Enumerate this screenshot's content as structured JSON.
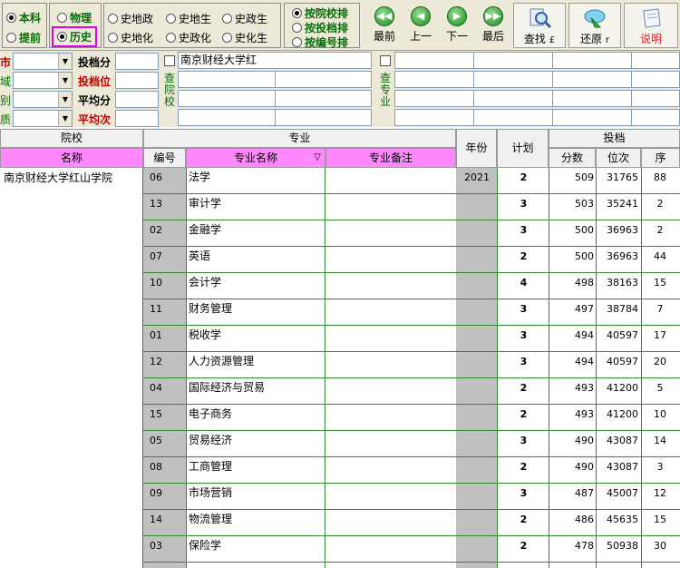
{
  "toolbar": {
    "level": [
      {
        "label": "本科",
        "checked": true
      },
      {
        "label": "提前",
        "checked": false
      }
    ],
    "subject": [
      {
        "label": "物理",
        "checked": false
      },
      {
        "label": "历史",
        "checked": true
      }
    ],
    "combos_row1": [
      "史地政",
      "史地生",
      "史政生"
    ],
    "combos_row2": [
      "史地化",
      "史政化",
      "史化生"
    ],
    "sort_options": [
      "按院校排",
      "按投档排",
      "按编号排"
    ],
    "nav": [
      "最前",
      "上一",
      "下一",
      "最后"
    ],
    "find_label": "查找",
    "find_key": "£",
    "restore_label": "还原",
    "restore_key": "r",
    "help_label": "说明"
  },
  "filters": {
    "left_labels": [
      "市",
      "域",
      "别",
      "质"
    ],
    "score_labels": [
      "投档分",
      "投档位",
      "平均分",
      "平均次"
    ],
    "school_search_value": "南京财经大学红",
    "school_vertical_label": [
      "查",
      "院",
      "校"
    ],
    "major_vertical_label": [
      "查",
      "专",
      "业"
    ]
  },
  "table": {
    "group_school": "院校",
    "group_major": "专业",
    "group_toudang": "投档",
    "col_name": "名称",
    "col_code": "编号",
    "col_major_name": "专业名称",
    "col_major_note": "专业备注",
    "col_year": "年份",
    "col_plan": "计划",
    "col_score": "分数",
    "col_rank": "位次",
    "col_seq": "序",
    "school_name": "南京财经大学红山学院",
    "year": "2021",
    "rows": [
      {
        "code": "06",
        "major": "法学",
        "plan": "2",
        "score": "509",
        "rank": "31765",
        "seq": "88"
      },
      {
        "code": "13",
        "major": "审计学",
        "plan": "3",
        "score": "503",
        "rank": "35241",
        "seq": "2"
      },
      {
        "code": "02",
        "major": "金融学",
        "plan": "3",
        "score": "500",
        "rank": "36963",
        "seq": "2"
      },
      {
        "code": "07",
        "major": "英语",
        "plan": "2",
        "score": "500",
        "rank": "36963",
        "seq": "44"
      },
      {
        "code": "10",
        "major": "会计学",
        "plan": "4",
        "score": "498",
        "rank": "38163",
        "seq": "15"
      },
      {
        "code": "11",
        "major": "财务管理",
        "plan": "3",
        "score": "497",
        "rank": "38784",
        "seq": "7"
      },
      {
        "code": "01",
        "major": "税收学",
        "plan": "3",
        "score": "494",
        "rank": "40597",
        "seq": "17"
      },
      {
        "code": "12",
        "major": "人力资源管理",
        "plan": "3",
        "score": "494",
        "rank": "40597",
        "seq": "20"
      },
      {
        "code": "04",
        "major": "国际经济与贸易",
        "plan": "2",
        "score": "493",
        "rank": "41200",
        "seq": "5"
      },
      {
        "code": "15",
        "major": "电子商务",
        "plan": "2",
        "score": "493",
        "rank": "41200",
        "seq": "10"
      },
      {
        "code": "05",
        "major": "贸易经济",
        "plan": "3",
        "score": "490",
        "rank": "43087",
        "seq": "14"
      },
      {
        "code": "08",
        "major": "工商管理",
        "plan": "2",
        "score": "490",
        "rank": "43087",
        "seq": "3"
      },
      {
        "code": "09",
        "major": "市场营销",
        "plan": "3",
        "score": "487",
        "rank": "45007",
        "seq": "12"
      },
      {
        "code": "14",
        "major": "物流管理",
        "plan": "2",
        "score": "486",
        "rank": "45635",
        "seq": "15"
      },
      {
        "code": "03",
        "major": "保险学",
        "plan": "2",
        "score": "478",
        "rank": "50938",
        "seq": "30"
      }
    ]
  }
}
